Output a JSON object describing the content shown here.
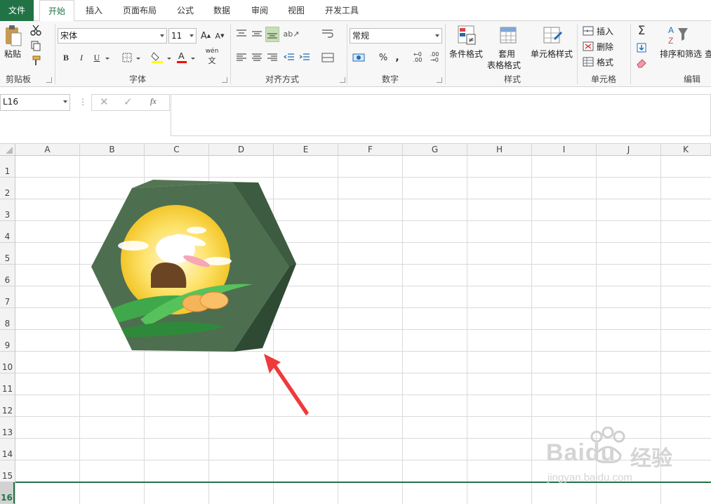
{
  "tabs": [
    "文件",
    "开始",
    "插入",
    "页面布局",
    "公式",
    "数据",
    "审阅",
    "视图",
    "开发工具"
  ],
  "clipboard": {
    "paste_label": "粘贴",
    "group_label": "剪贴板"
  },
  "font": {
    "family": "宋体",
    "size": "11",
    "group_label": "字体",
    "bold": "B",
    "italic": "I",
    "underline": "U",
    "font_color": "#ff0000",
    "fill_color": "#ffff00",
    "phonetic": "wén"
  },
  "alignment": {
    "group_label": "对齐方式"
  },
  "number": {
    "format": "常规",
    "group_label": "数字",
    "percent": "%",
    "comma": ","
  },
  "styles": {
    "conditional": "条件格式",
    "table1": "套用",
    "table2": "表格格式",
    "cell_styles": "单元格样式",
    "group_label": "样式"
  },
  "cells": {
    "insert": "插入",
    "delete": "删除",
    "format": "格式",
    "group_label": "单元格"
  },
  "editing": {
    "sort_filter": "排序和筛选",
    "group_label": "编辑",
    "find_char": "查"
  },
  "formula_bar": {
    "name_box": "L16",
    "fx": "fx",
    "content": ""
  },
  "columns": [
    "A",
    "B",
    "C",
    "D",
    "E",
    "F",
    "G",
    "H",
    "I",
    "J",
    "K"
  ],
  "rows": [
    "1",
    "2",
    "3",
    "4",
    "5",
    "6",
    "7",
    "8",
    "9",
    "10",
    "11",
    "12",
    "13",
    "14",
    "15",
    "16"
  ],
  "selected_row": "16",
  "watermark": {
    "brand": "Baidu",
    "brand_cn": "经验",
    "url": "jingyan.baidu.com"
  },
  "colors": {
    "accent": "#217346",
    "hex_front": "#4e6e50",
    "hex_side": "#35523a",
    "arrow": "#ee3a3a"
  }
}
